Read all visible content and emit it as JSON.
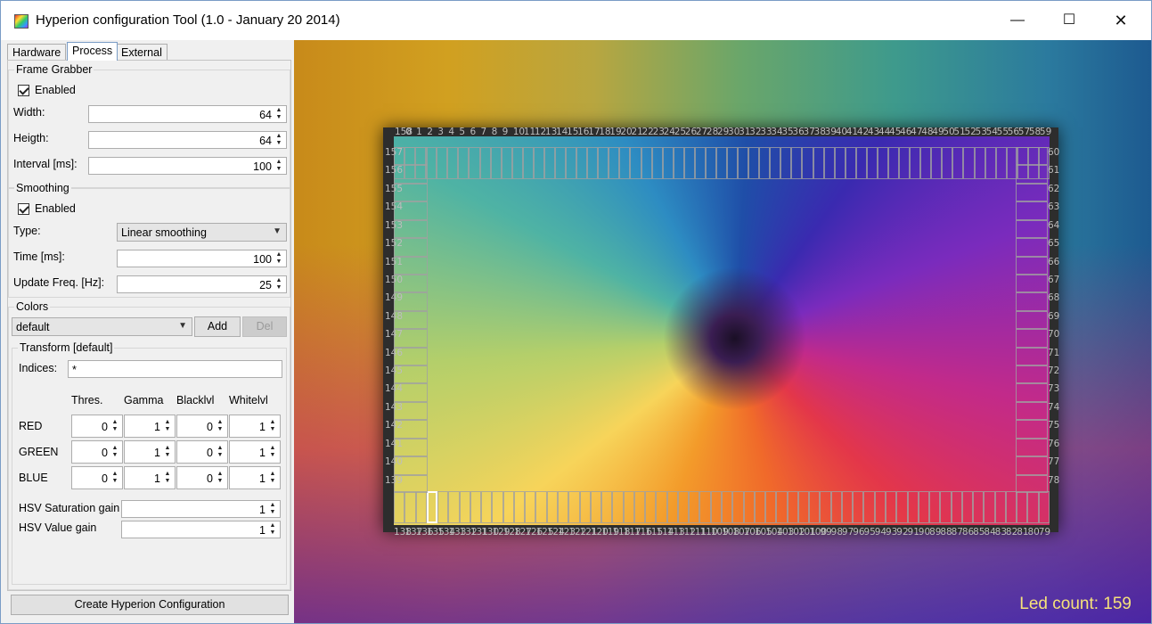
{
  "window": {
    "title": "Hyperion configuration Tool (1.0 - January 20 2014)",
    "minimize": "—",
    "maximize": "☐",
    "close": "✕"
  },
  "tabs": [
    "Hardware",
    "Process",
    "External"
  ],
  "active_tab": "Process",
  "frame_grabber": {
    "title": "Frame Grabber",
    "enabled_label": "Enabled",
    "enabled": true,
    "width_label": "Width:",
    "width": "64",
    "height_label": "Heigth:",
    "height": "64",
    "interval_label": "Interval [ms]:",
    "interval": "100"
  },
  "smoothing": {
    "title": "Smoothing",
    "enabled_label": "Enabled",
    "enabled": true,
    "type_label": "Type:",
    "type": "Linear smoothing",
    "time_label": "Time [ms]:",
    "time": "100",
    "freq_label": "Update Freq. [Hz]:",
    "freq": "25"
  },
  "colors": {
    "title": "Colors",
    "selected": "default",
    "add_label": "Add",
    "del_label": "Del",
    "transform": {
      "title": "Transform [default]",
      "indices_label": "Indices:",
      "indices": "*",
      "columns": [
        "Thres.",
        "Gamma",
        "Blacklvl",
        "Whitelvl"
      ],
      "rows": [
        {
          "label": "RED",
          "values": [
            "0",
            "1",
            "0",
            "1"
          ]
        },
        {
          "label": "GREEN",
          "values": [
            "0",
            "1",
            "0",
            "1"
          ]
        },
        {
          "label": "BLUE",
          "values": [
            "0",
            "1",
            "0",
            "1"
          ]
        }
      ],
      "hsv_sat_label": "HSV Saturation gain",
      "hsv_sat": "1",
      "hsv_val_label": "HSV Value gain",
      "hsv_val": "1"
    }
  },
  "create_button": "Create Hyperion Configuration",
  "preview": {
    "led_count_label": "Led count: 159",
    "top_numbers": [
      "158",
      "0",
      "1",
      "2",
      "3",
      "4",
      "5",
      "6",
      "7",
      "8",
      "9",
      "10",
      "11",
      "12",
      "13",
      "14",
      "15",
      "16",
      "17",
      "18",
      "19",
      "20",
      "21",
      "22",
      "23",
      "24",
      "25",
      "26",
      "27",
      "28",
      "29",
      "30",
      "31",
      "32",
      "33",
      "34",
      "35",
      "36",
      "37",
      "38",
      "39",
      "40",
      "41",
      "42",
      "43",
      "44",
      "45",
      "46",
      "47",
      "48",
      "49",
      "50",
      "51",
      "52",
      "53",
      "54",
      "55",
      "56",
      "57",
      "58",
      "59"
    ],
    "right_numbers": [
      "60",
      "61",
      "62",
      "63",
      "64",
      "65",
      "66",
      "67",
      "68",
      "69",
      "70",
      "71",
      "72",
      "73",
      "74",
      "75",
      "76",
      "77",
      "78"
    ],
    "left_numbers": [
      "157",
      "156",
      "155",
      "154",
      "153",
      "152",
      "151",
      "150",
      "149",
      "148",
      "147",
      "146",
      "145",
      "144",
      "143",
      "142",
      "141",
      "140",
      "139"
    ],
    "bottom_numbers": [
      "138",
      "137",
      "136",
      "135",
      "134",
      "133",
      "132",
      "131",
      "130",
      "129",
      "128",
      "127",
      "126",
      "125",
      "124",
      "123",
      "122",
      "121",
      "120",
      "119",
      "118",
      "117",
      "116",
      "115",
      "114",
      "113",
      "112",
      "111",
      "110",
      "109",
      "108",
      "107",
      "106",
      "105",
      "104",
      "103",
      "102",
      "101",
      "100",
      "99",
      "98",
      "97",
      "96",
      "95",
      "94",
      "93",
      "92",
      "91",
      "90",
      "89",
      "88",
      "87",
      "86",
      "85",
      "84",
      "83",
      "82",
      "81",
      "80",
      "79"
    ]
  }
}
